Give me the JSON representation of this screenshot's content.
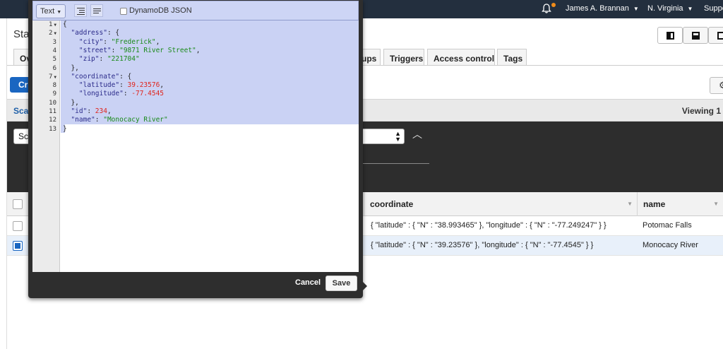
{
  "topnav": {
    "user": "James A. Brannan",
    "region": "N. Virginia",
    "support": "Support"
  },
  "page": {
    "title": "Sta",
    "tabs": [
      "Ov",
      "ups",
      "Triggers",
      "Access control",
      "Tags"
    ],
    "create_label": "Cr",
    "scan_label": "Sca",
    "viewing": "Viewing 1",
    "scan_select": "Sc"
  },
  "table": {
    "columns": [
      "coordinate",
      "name"
    ],
    "rows": [
      {
        "coordinate": "{ \"latitude\" : { \"N\" : \"38.993465\" }, \"longitude\" : { \"N\" : \"-77.249247\" } }",
        "name": "Potomac Falls",
        "selected": false
      },
      {
        "coordinate": "{ \"latitude\" : { \"N\" : \"39.23576\" }, \"longitude\" : { \"N\" : \"-77.4545\" } }",
        "name": "Monocacy River",
        "selected": true
      }
    ]
  },
  "editor": {
    "mode": "Text",
    "dynamodb_json_label": "DynamoDB JSON",
    "cancel_label": "Cancel",
    "save_label": "Save",
    "line_numbers": [
      "1",
      "2",
      "3",
      "4",
      "5",
      "6",
      "7",
      "8",
      "9",
      "10",
      "11",
      "12",
      "13"
    ],
    "lines": [
      "{",
      "  \"address\": {",
      "    \"city\": \"Frederick\",",
      "    \"street\": \"9871 River Street\",",
      "    \"zip\": \"221704\"",
      "  },",
      "  \"coordinate\": {",
      "    \"latitude\": 39.23576,",
      "    \"longitude\": -77.4545",
      "  },",
      "  \"id\": 234,",
      "  \"name\": \"Monocacy River\"",
      "}"
    ]
  },
  "colors": {
    "nav_bg": "#232f3e",
    "primary_blue": "#1a66c1",
    "selection": "#cad2f4",
    "json_string": "#1a8a1a",
    "json_number": "#e0241c",
    "json_key": "#2b2b8a",
    "notification_dot": "#f08c1a"
  },
  "icons": [
    "bell-icon",
    "settings-gear-icon",
    "chevron-up-icon",
    "format-icon",
    "compact-icon"
  ]
}
